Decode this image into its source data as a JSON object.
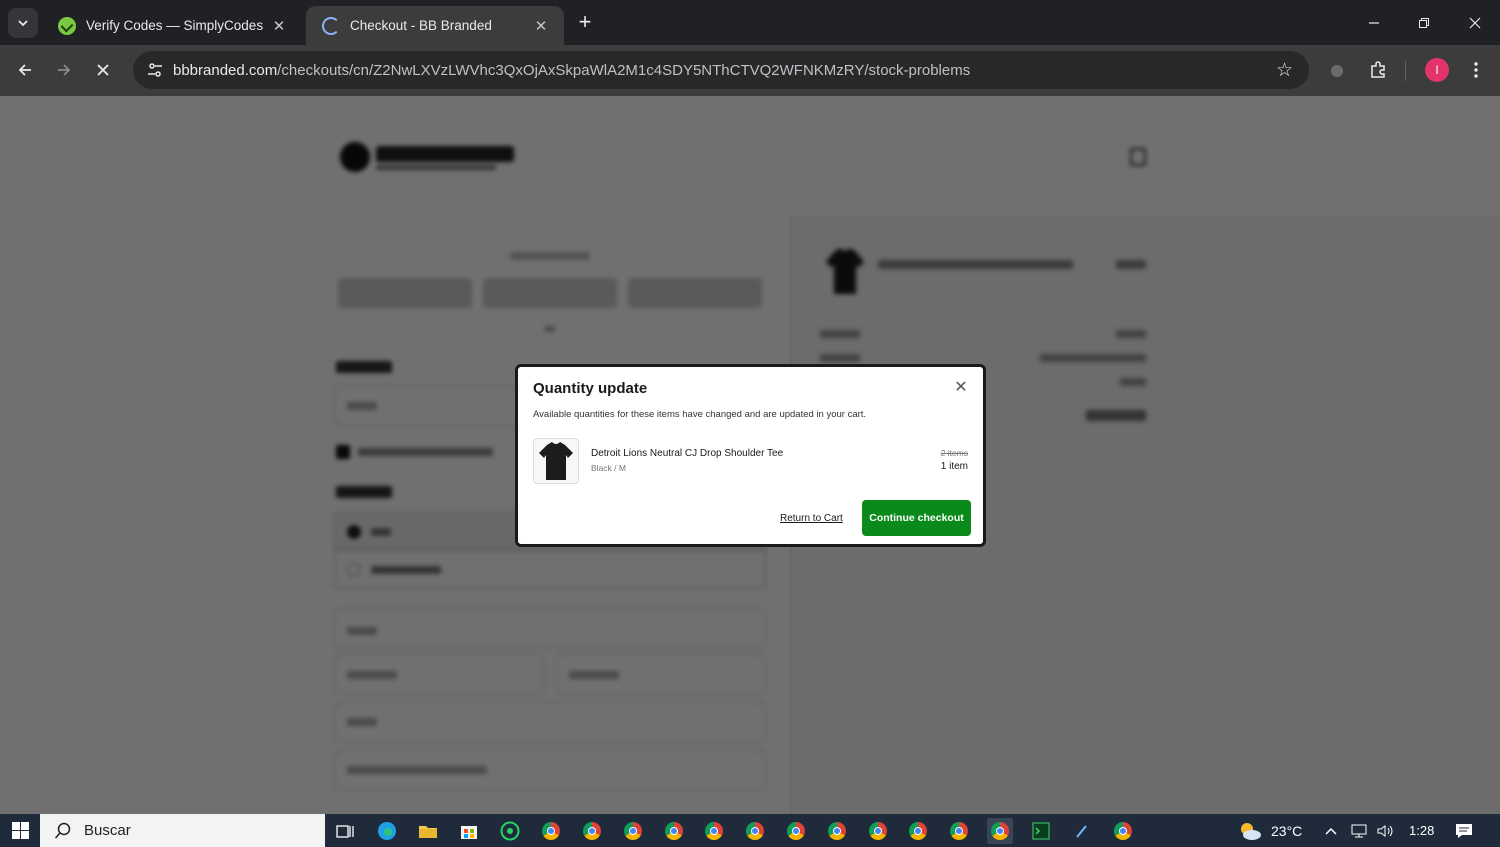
{
  "browser": {
    "tabs": [
      {
        "title": "Verify Codes — SimplyCodes",
        "favicon": "simplycodes-icon",
        "active": false
      },
      {
        "title": "Checkout - BB Branded",
        "favicon": "loading-icon",
        "active": true
      }
    ],
    "url_host": "bbbranded.com",
    "url_path": "/checkouts/cn/Z2NwLXVzLWVhc3QxOjAxSkpaWlA2M1c4SDY5NThCTVQ2WFNKMzRY/stock-problems",
    "profile_initial": "I",
    "profile_color": "#e2336b"
  },
  "modal": {
    "title": "Quantity update",
    "description": "Available quantities for these items have changed and are updated in your cart.",
    "item": {
      "name": "Detroit Lions Neutral CJ Drop Shoulder Tee",
      "variant": "Black / M",
      "old_quantity": "2 items",
      "new_quantity": "1 item"
    },
    "return_label": "Return to Cart",
    "continue_label": "Continue checkout",
    "continue_color": "#0a8a1a"
  },
  "taskbar": {
    "search_placeholder": "Buscar",
    "temperature": "23°C",
    "time": "1:28"
  }
}
